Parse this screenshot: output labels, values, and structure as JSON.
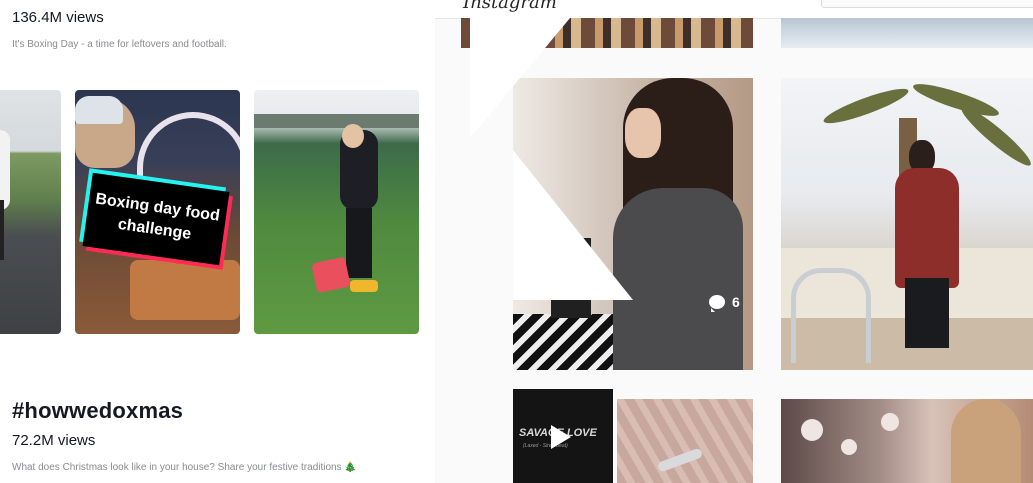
{
  "tiktok": {
    "trend1": {
      "views": "136.4M views",
      "description": "It's Boxing Day - a time for leftovers and football."
    },
    "videos": [
      {
        "caption": ""
      },
      {
        "caption": "Boxing day food challenge"
      },
      {
        "caption": ""
      }
    ],
    "trend2": {
      "hashtag": "#howwedoxmas",
      "views": "72.2M views",
      "description": "What does Christmas look like in your house? Share your festive traditions 🎄"
    }
  },
  "instagram": {
    "logo": "Instagram",
    "posts": [
      {
        "comments": "6"
      },
      {
        "video_title": "SAVAGE LOVE",
        "video_subtitle": "(Laxed - Siren Beat)"
      }
    ]
  },
  "icons": {
    "comment": "comment-bubble-icon",
    "play": "play-icon"
  },
  "colors": {
    "tiktok_cyan": "#25f4ee",
    "tiktok_red": "#fe2c55",
    "text_primary": "#161823",
    "text_secondary": "#8a8b91"
  }
}
